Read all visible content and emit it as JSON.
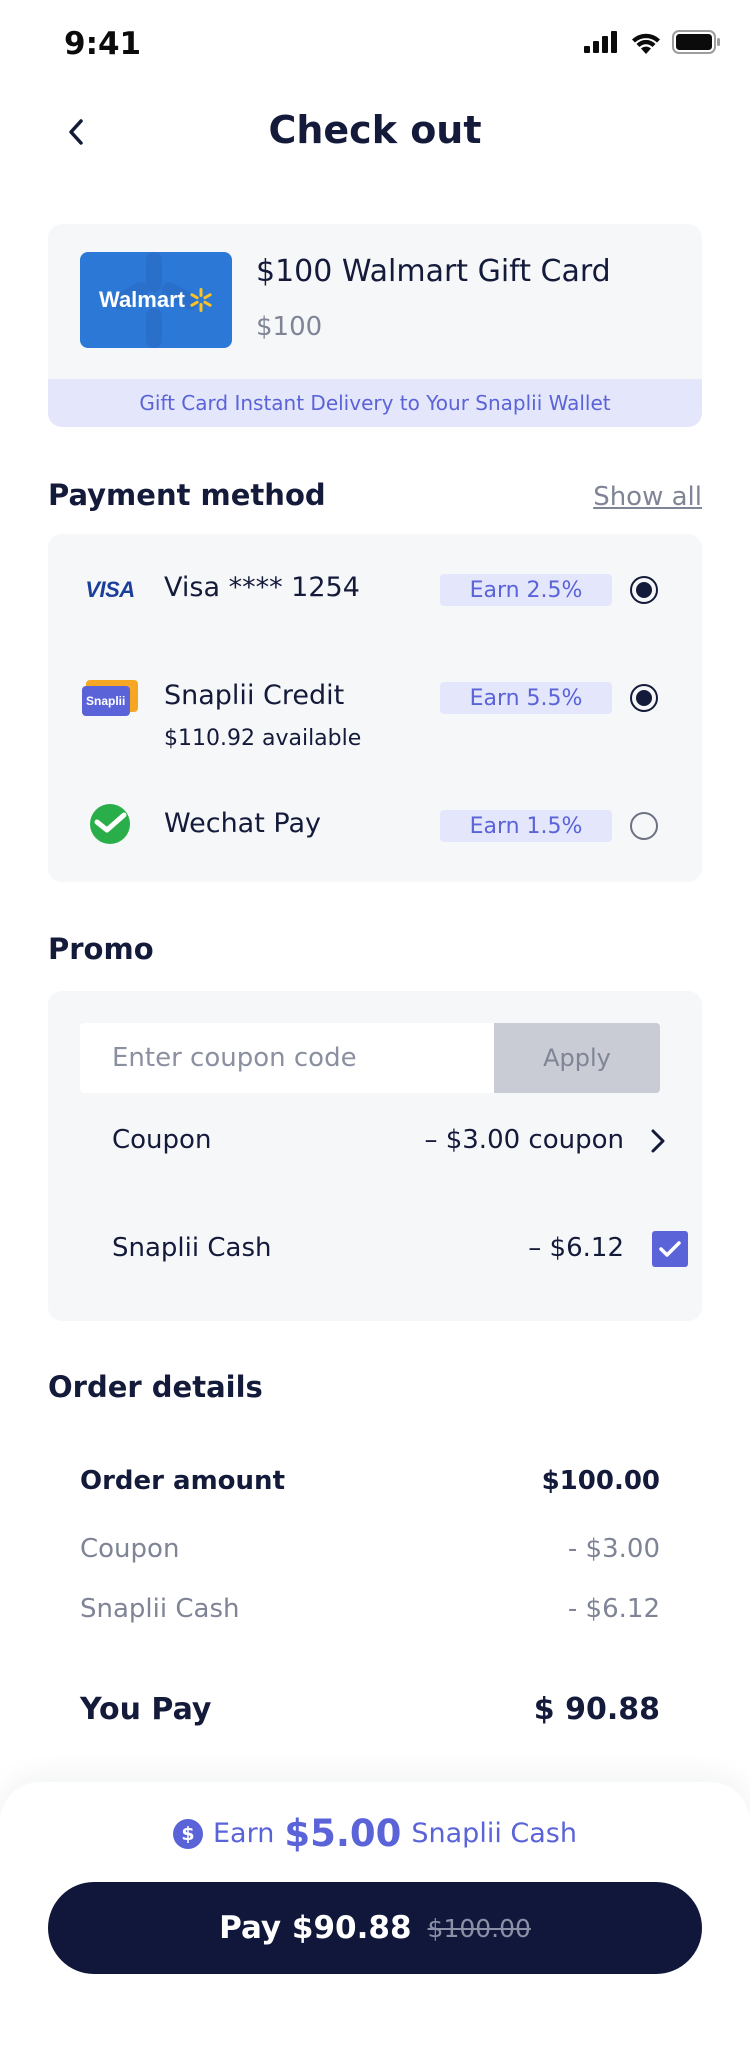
{
  "status_bar": {
    "time": "9:41"
  },
  "header": {
    "title": "Check out"
  },
  "product": {
    "name": "$100 Walmart Gift Card",
    "price": "$100",
    "brand_logo_text": "Walmart",
    "delivery_note": "Gift Card Instant Delivery to Your Snaplii Wallet"
  },
  "payment": {
    "title": "Payment method",
    "show_all": "Show all",
    "methods": [
      {
        "name": "Visa **** 1254",
        "sub": "",
        "earn": "Earn 2.5%",
        "selected": true,
        "icon": "visa-logo",
        "logo_text": "VISA"
      },
      {
        "name": "Snaplii Credit",
        "sub": "$110.92 available",
        "earn": "Earn 5.5%",
        "selected": true,
        "icon": "snaplii-credit-logo",
        "logo_text": "Snaplii"
      },
      {
        "name": "Wechat Pay",
        "sub": "",
        "earn": "Earn 1.5%",
        "selected": false,
        "icon": "wechat-pay-logo"
      }
    ]
  },
  "promo": {
    "title": "Promo",
    "input_placeholder": "Enter coupon code",
    "apply_label": "Apply",
    "coupon_label": "Coupon",
    "coupon_value": "– $3.00 coupon",
    "cash_label": "Snaplii Cash",
    "cash_value": "– $6.12",
    "cash_checked": true
  },
  "order": {
    "title": "Order details",
    "rows": [
      {
        "label": "Order amount",
        "value": "$100.00"
      },
      {
        "label": "Coupon",
        "value": "- $3.00"
      },
      {
        "label": "Snaplii Cash",
        "value": "- $6.12"
      }
    ],
    "total_label": "You Pay",
    "total_value": "$ 90.88"
  },
  "footer": {
    "earn_prefix": "Earn",
    "earn_amount": "$5.00",
    "earn_suffix": "Snaplii Cash",
    "pay_label": "Pay $90.88",
    "original_price": "$100.00"
  },
  "colors": {
    "accent": "#5a63d8",
    "navy": "#10173a",
    "panel": "#f6f7f9",
    "badge_bg": "#e4e6fb"
  }
}
